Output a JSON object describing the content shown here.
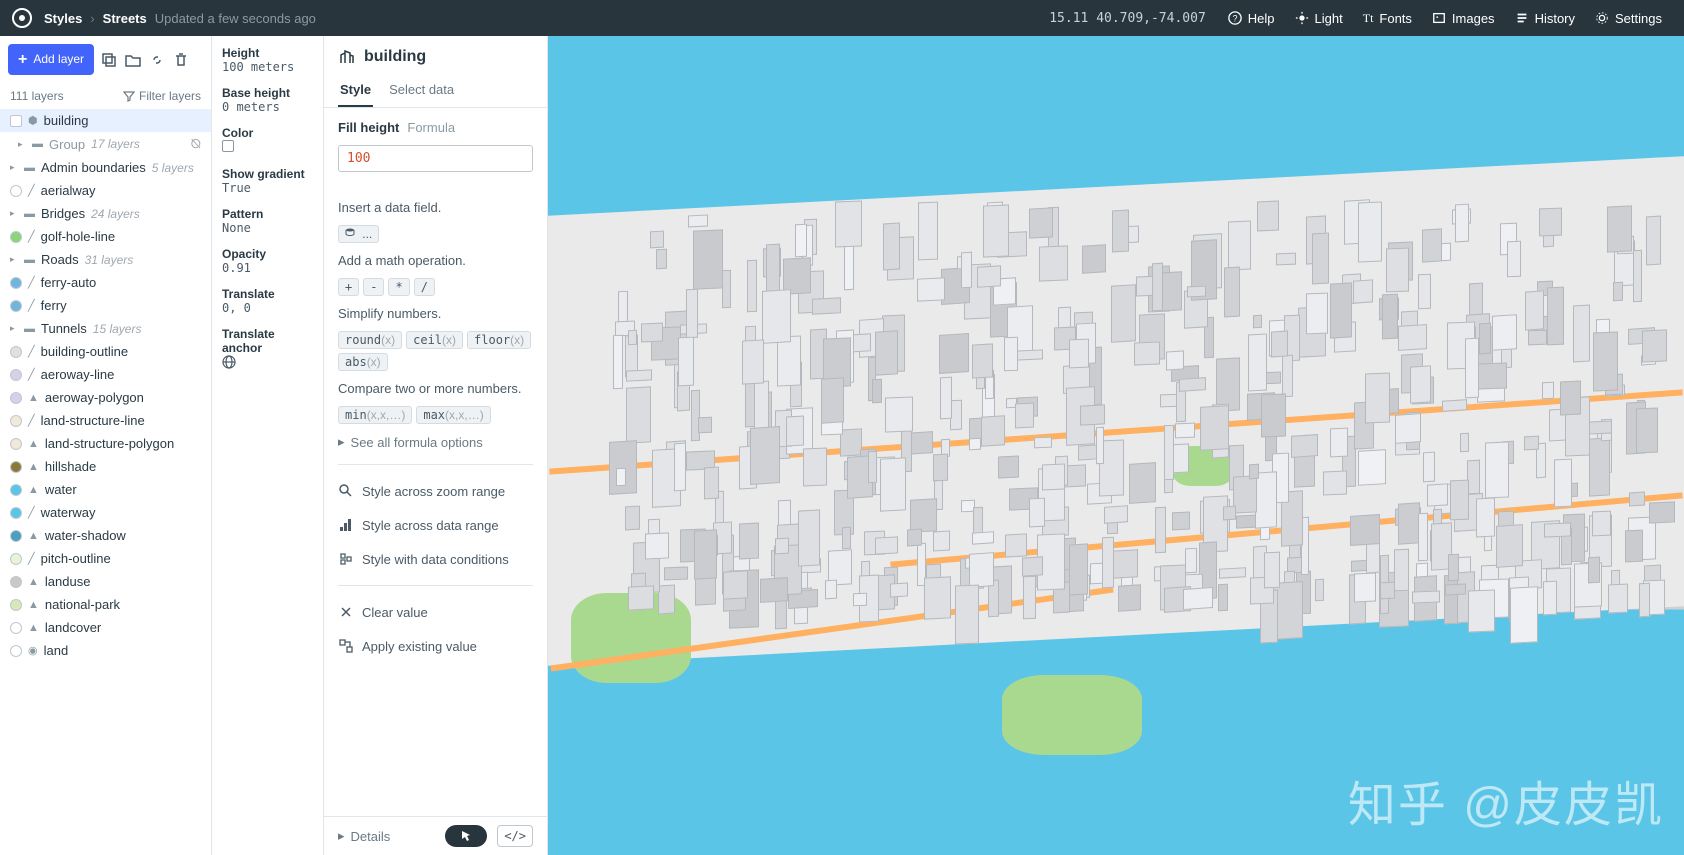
{
  "topbar": {
    "crumb1": "Styles",
    "crumb2": "Streets",
    "saved": "Updated a few seconds ago",
    "coords": "15.11 40.709,-74.007",
    "help": "Help",
    "light": "Light",
    "fonts": "Fonts",
    "images": "Images",
    "history": "History",
    "settings": "Settings"
  },
  "layers": {
    "add_label": "Add layer",
    "count": "111 layers",
    "filter": "Filter layers",
    "items": [
      {
        "name": "building",
        "selected": true,
        "swatch": "#ffffff",
        "shape": "sq",
        "type": "extrusion"
      },
      {
        "name": "Group",
        "count": "17 layers",
        "group": true,
        "child": true
      },
      {
        "name": "Admin boundaries",
        "count": "5 layers",
        "group": true
      },
      {
        "name": "aerialway",
        "swatch": "#ffffff",
        "type": "line"
      },
      {
        "name": "Bridges",
        "count": "24 layers",
        "group": true
      },
      {
        "name": "golf-hole-line",
        "swatch": "#8bd47a",
        "type": "line"
      },
      {
        "name": "Roads",
        "count": "31 layers",
        "group": true
      },
      {
        "name": "ferry-auto",
        "swatch": "#6fb5e0",
        "type": "line"
      },
      {
        "name": "ferry",
        "swatch": "#6fb5e0",
        "type": "line"
      },
      {
        "name": "Tunnels",
        "count": "15 layers",
        "group": true
      },
      {
        "name": "building-outline",
        "swatch": "#e0e0e0",
        "type": "line"
      },
      {
        "name": "aeroway-line",
        "swatch": "#d8cfe8",
        "type": "line"
      },
      {
        "name": "aeroway-polygon",
        "swatch": "#d8cfe8",
        "type": "fill"
      },
      {
        "name": "land-structure-line",
        "swatch": "#f0e8d8",
        "type": "line"
      },
      {
        "name": "land-structure-polygon",
        "swatch": "#f0e8d8",
        "type": "fill"
      },
      {
        "name": "hillshade",
        "swatch": "#8a7a3a",
        "type": "fill"
      },
      {
        "name": "water",
        "swatch": "#5bc5e8",
        "type": "fill"
      },
      {
        "name": "waterway",
        "swatch": "#5bc5e8",
        "type": "line"
      },
      {
        "name": "water-shadow",
        "swatch": "#4a9ec0",
        "type": "fill"
      },
      {
        "name": "pitch-outline",
        "swatch": "#e8f4d8",
        "type": "line"
      },
      {
        "name": "landuse",
        "swatch": "#c8c8c8",
        "type": "fill",
        "dash": true
      },
      {
        "name": "national-park",
        "swatch": "#d8e8b8",
        "type": "fill"
      },
      {
        "name": "landcover",
        "swatch": "#ffffff",
        "type": "fill"
      },
      {
        "name": "land",
        "swatch": "#ffffff",
        "type": "bg"
      }
    ]
  },
  "props": {
    "title": "building",
    "height_label": "Height",
    "height_val": "100 meters",
    "base_label": "Base height",
    "base_val": "0 meters",
    "color_label": "Color",
    "grad_label": "Show gradient",
    "grad_val": "True",
    "pattern_label": "Pattern",
    "pattern_val": "None",
    "opacity_label": "Opacity",
    "opacity_val": "0.91",
    "translate_label": "Translate",
    "translate_val": "0, 0",
    "anchor_label": "Translate anchor"
  },
  "editor": {
    "tab_style": "Style",
    "tab_select": "Select data",
    "field_label": "Fill height",
    "field_type": "Formula",
    "formula_value": "100",
    "hint_data": "Insert a data field.",
    "chip_data": "...",
    "hint_math": "Add a math operation.",
    "chips_math": [
      "+",
      "-",
      "*",
      "/"
    ],
    "hint_simplify": "Simplify numbers.",
    "chips_simplify": [
      "round(x)",
      "ceil(x)",
      "floor(x)",
      "abs(x)"
    ],
    "hint_compare": "Compare two or more numbers.",
    "chips_compare": [
      "min(x,x,…)",
      "max(x,x,…)"
    ],
    "see_more": "See all formula options",
    "action_zoom": "Style across zoom range",
    "action_data": "Style across data range",
    "action_cond": "Style with data conditions",
    "action_clear": "Clear value",
    "action_apply": "Apply existing value",
    "details": "Details"
  },
  "watermark": "知乎 @皮皮凯"
}
